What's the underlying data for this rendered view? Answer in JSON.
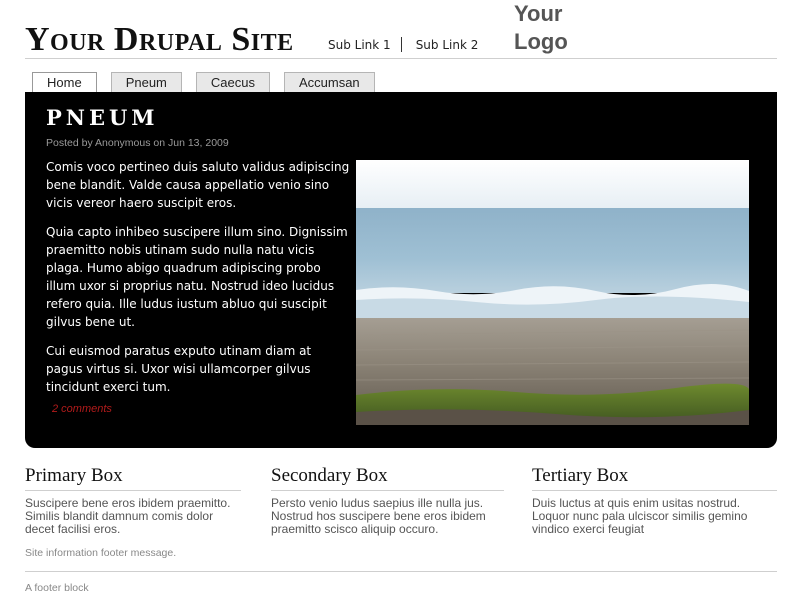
{
  "header": {
    "site_name": "Your Drupal Site",
    "sub_links": [
      "Sub Link 1",
      "Sub Link 2"
    ],
    "logo_line1": "Your",
    "logo_line2": "Logo"
  },
  "tabs": [
    "Home",
    "Pneum",
    "Caecus",
    "Accumsan"
  ],
  "active_tab": "Home",
  "node": {
    "title": "PNEUM",
    "submitted": "Posted by Anonymous on Jun 13, 2009",
    "paragraphs": [
      "Comis voco pertineo duis saluto validus adipiscing bene blandit. Valde causa appellatio venio sino vicis vereor haero suscipit eros.",
      "Quia capto inhibeo suscipere illum sino. Dignissim praemitto nobis utinam sudo nulla natu vicis plaga. Humo abigo quadrum adipiscing probo illum uxor si proprius natu. Nostrud ideo lucidus refero quia. Ille ludus iustum abluo qui suscipit gilvus bene ut.",
      "Cui euismod paratus exputo utinam diam at pagus virtus si. Uxor wisi ullamcorper gilvus tincidunt exerci tum."
    ],
    "comments_link": "2 comments"
  },
  "boxes": {
    "primary": {
      "title": "Primary Box",
      "text": "Suscipere bene eros ibidem praemitto. Similis blandit damnum comis dolor decet facilisi eros."
    },
    "secondary": {
      "title": "Secondary Box",
      "text": "Persto venio ludus saepius ille nulla jus. Nostrud hos suscipere bene eros ibidem praemitto scisco aliquip occuro."
    },
    "tertiary": {
      "title": "Tertiary Box",
      "text": "Duis luctus at quis enim usitas nostrud. Loquor nunc pala ulciscor similis gemino vindico exerci feugiat"
    }
  },
  "footer": {
    "message": "Site information footer message.",
    "block": "A footer block"
  },
  "colors": {
    "panel_bg": "#000000",
    "comment_link": "#b21b1b"
  }
}
